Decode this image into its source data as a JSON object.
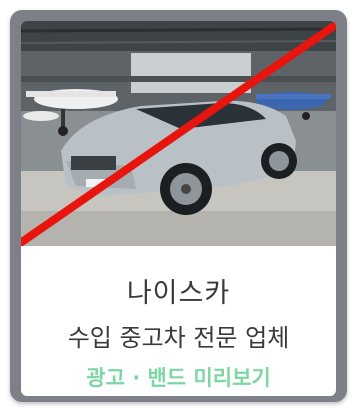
{
  "card": {
    "title": "나이스카",
    "subtitle": "수입 중고차 전문 업체",
    "link_text": "광고 · 밴드 미리보기"
  },
  "thumbnail": {
    "image_content": "silver SUV parked in an airplane hangar",
    "overlay": "red-strike-icon"
  },
  "colors": {
    "frame": "#7d8086",
    "title_text": "#3a3a3a",
    "link_green": "#7dd7a3",
    "strike_red": "#e8150e"
  }
}
